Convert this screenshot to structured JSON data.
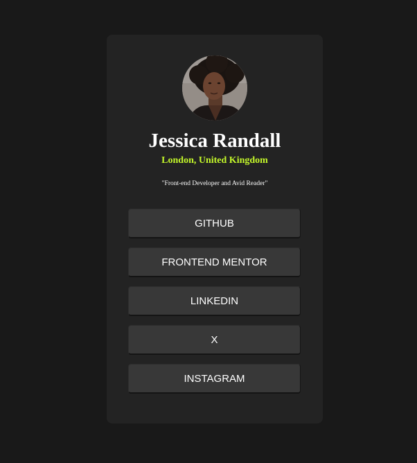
{
  "profile": {
    "name": "Jessica Randall",
    "location": "London, United Kingdom",
    "bio": "\"Front-end Developer and Avid Reader\""
  },
  "links": [
    {
      "label": "GITHUB"
    },
    {
      "label": "FRONTEND MENTOR"
    },
    {
      "label": "LINKEDIN"
    },
    {
      "label": "X"
    },
    {
      "label": "INSTAGRAM"
    }
  ],
  "colors": {
    "page_background": "#191919",
    "card_background": "#232323",
    "button_background": "#383838",
    "accent": "#c4f82a",
    "text": "#ffffff"
  }
}
